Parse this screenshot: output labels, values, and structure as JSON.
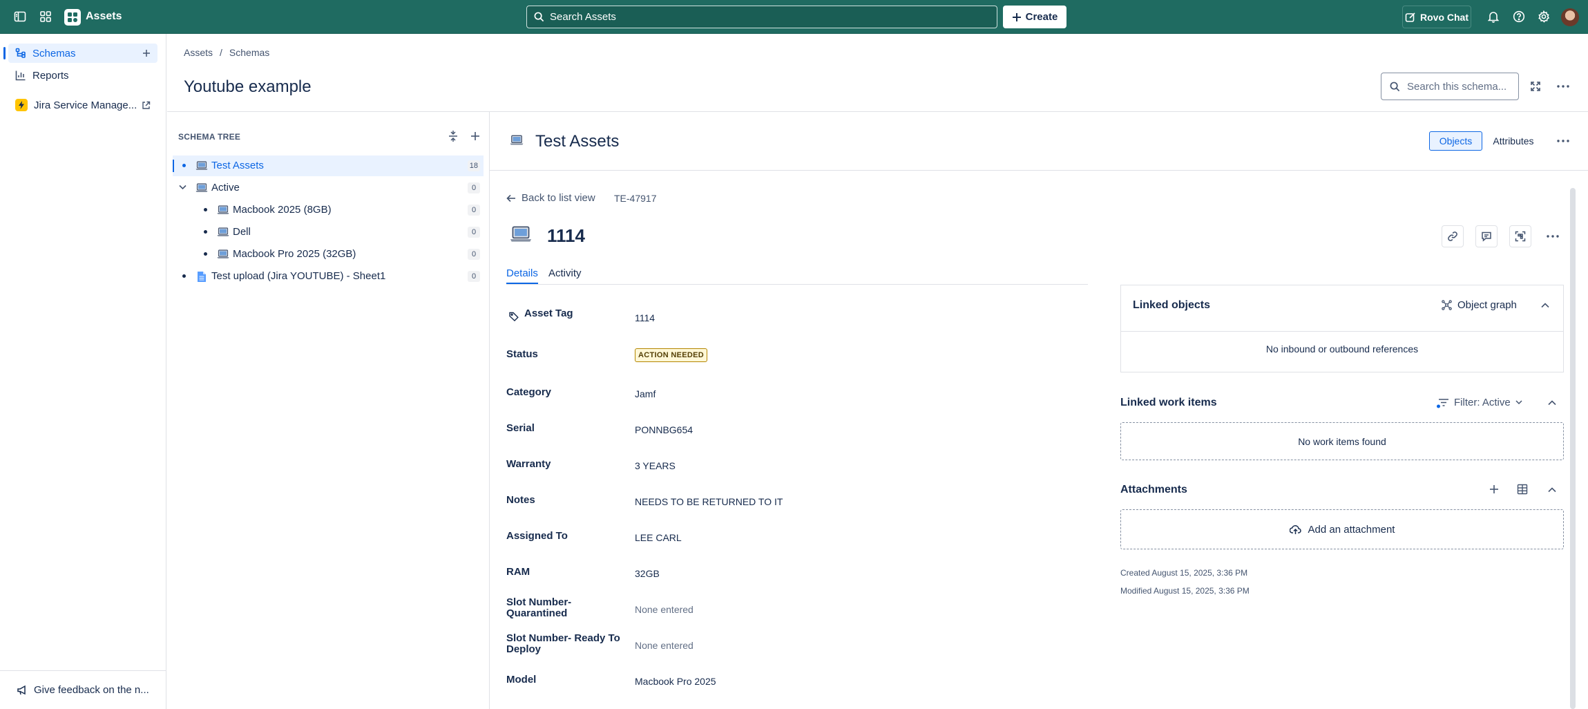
{
  "topbar": {
    "app_name": "Assets",
    "search_placeholder": "Search Assets",
    "create_label": "Create",
    "rovo_label": "Rovo Chat"
  },
  "sidebar": {
    "items": [
      {
        "label": "Schemas",
        "icon": "schema-icon"
      },
      {
        "label": "Reports",
        "icon": "chart-icon"
      },
      {
        "label": "Jira Service Manage...",
        "icon": "jsm-icon"
      }
    ],
    "feedback_label": "Give feedback on the n..."
  },
  "header": {
    "breadcrumb": [
      "Assets",
      "/",
      "Schemas"
    ],
    "title": "Youtube example",
    "schema_search_placeholder": "Search this schema..."
  },
  "tree": {
    "title": "SCHEMA TREE",
    "rows": [
      {
        "label": "Test Assets",
        "count": "18"
      },
      {
        "label": "Active",
        "count": "0"
      },
      {
        "label": "Macbook 2025 (8GB)",
        "count": "0"
      },
      {
        "label": "Dell",
        "count": "0"
      },
      {
        "label": "Macbook Pro 2025 (32GB)",
        "count": "0"
      },
      {
        "label": "Test upload (Jira YOUTUBE) - Sheet1",
        "count": "0"
      }
    ]
  },
  "main": {
    "title": "Test Assets",
    "view_toggle": [
      "Objects",
      "Attributes"
    ],
    "back_label": "Back to list view",
    "object_key": "TE-47917",
    "object_name": "1114",
    "tabs": [
      "Details",
      "Activity"
    ],
    "attributes": [
      {
        "label": "Asset Tag",
        "value": "1114"
      },
      {
        "label": "Status",
        "value": "ACTION NEEDED"
      },
      {
        "label": "Category",
        "value": "Jamf"
      },
      {
        "label": "Serial",
        "value": "PONNBG654"
      },
      {
        "label": "Warranty",
        "value": "3 YEARS"
      },
      {
        "label": "Notes",
        "value": "NEEDS TO BE RETURNED TO IT"
      },
      {
        "label": "Assigned To",
        "value": "LEE CARL"
      },
      {
        "label": "RAM",
        "value": "32GB"
      },
      {
        "label": "Slot Number- Quarantined",
        "value": "None entered"
      },
      {
        "label": "Slot Number- Ready To Deploy",
        "value": "None entered"
      },
      {
        "label": "Model",
        "value": "Macbook Pro 2025"
      }
    ]
  },
  "right": {
    "linked_objects": {
      "title": "Linked objects",
      "graph_label": "Object graph",
      "empty": "No inbound or outbound references"
    },
    "linked_work": {
      "title": "Linked work items",
      "filter_label": "Filter: Active",
      "empty": "No work items found"
    },
    "attachments": {
      "title": "Attachments",
      "add_label": "Add an attachment"
    },
    "created": "Created August 15, 2025, 3:36 PM",
    "modified": "Modified August 15, 2025, 3:36 PM"
  },
  "colors": {
    "topbar": "#1f6b61",
    "accent": "#0c66e4",
    "status_lozenge": "#fff7d6"
  }
}
